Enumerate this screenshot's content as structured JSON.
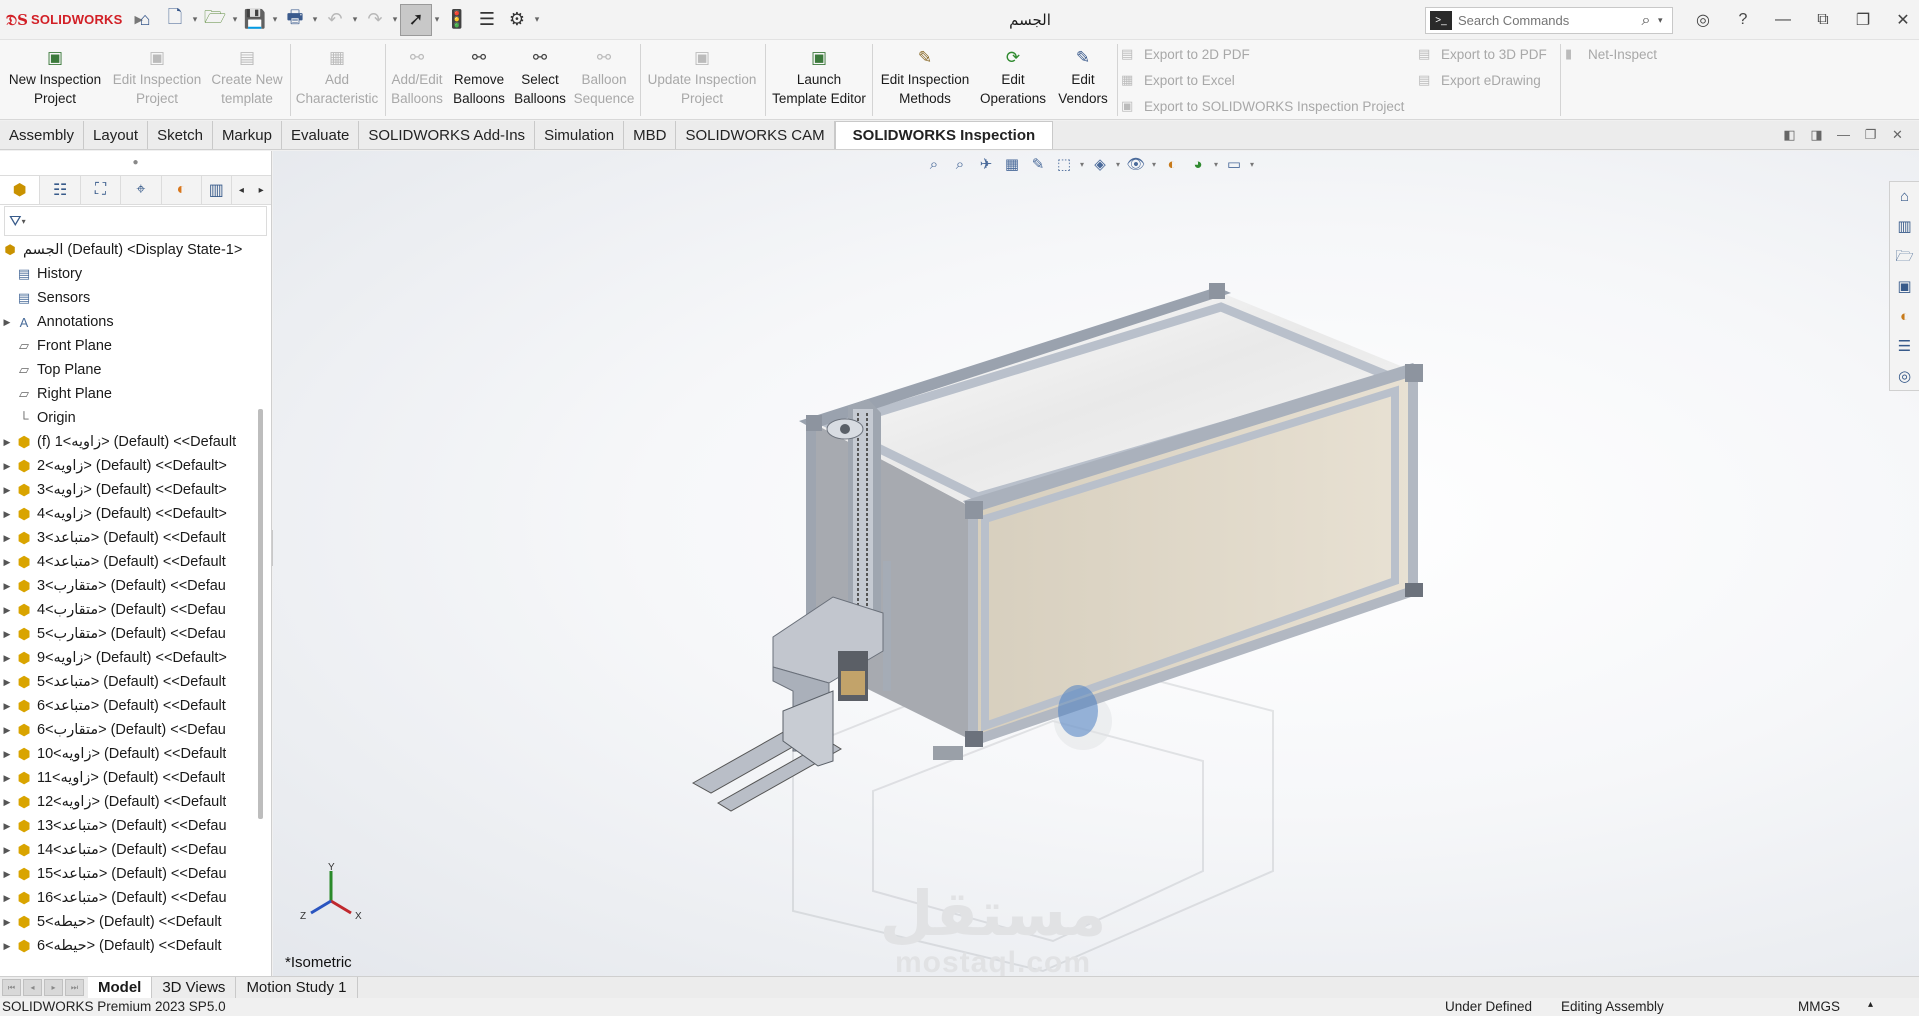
{
  "app": {
    "brand": "SOLIDWORKS",
    "document_title": "الجسم"
  },
  "search": {
    "placeholder": "Search Commands"
  },
  "commands": {
    "new_inspection_project": "New Inspection Project",
    "edit_inspection_project": "Edit Inspection Project",
    "create_new_template": "Create New template",
    "add_characteristic": "Add Characteristic",
    "add_edit_balloons": "Add/Edit Balloons",
    "remove_balloons": "Remove Balloons",
    "select_balloons": "Select Balloons",
    "balloon_sequence": "Balloon Sequence",
    "update_inspection_project": "Update Inspection Project",
    "launch_template_editor": "Launch Template Editor",
    "edit_inspection_methods": "Edit Inspection Methods",
    "edit_operations": "Edit Operations",
    "edit_vendors": "Edit Vendors",
    "export_2d_pdf": "Export to 2D PDF",
    "export_excel": "Export to Excel",
    "export_sw_inspection": "Export to SOLIDWORKS Inspection Project",
    "export_3d_pdf": "Export to 3D PDF",
    "export_edrawing": "Export eDrawing",
    "net_inspect": "Net-Inspect"
  },
  "tabs": [
    "Assembly",
    "Layout",
    "Sketch",
    "Markup",
    "Evaluate",
    "SOLIDWORKS Add-Ins",
    "Simulation",
    "MBD",
    "SOLIDWORKS CAM",
    "SOLIDWORKS Inspection"
  ],
  "active_tab": "SOLIDWORKS Inspection",
  "tree": {
    "root": "الجسم (Default) <Display State-1>",
    "fixed_items": [
      "History",
      "Sensors",
      "Annotations",
      "Front Plane",
      "Top Plane",
      "Right Plane",
      "Origin"
    ],
    "components": [
      "(f) 1<زاويه> (Default) <<Default",
      "2<زاويه> (Default) <<Default>",
      "3<زاويه> (Default) <<Default>",
      "4<زاويه> (Default) <<Default>",
      "3<متباعد> (Default) <<Default",
      "4<متباعد> (Default) <<Default",
      "3<متقارب> (Default) <<Defau",
      "4<متقارب> (Default) <<Defau",
      "5<متقارب> (Default) <<Defau",
      "9<زاويه> (Default) <<Default>",
      "5<متباعد> (Default) <<Default",
      "6<متباعد> (Default) <<Default",
      "6<متقارب> (Default) <<Defau",
      "10<زاويه> (Default) <<Default",
      "11<زاويه> (Default) <<Default",
      "12<زاويه> (Default) <<Default",
      "13<متباعد> (Default) <<Defau",
      "14<متباعد> (Default) <<Defau",
      "15<متباعد> (Default) <<Defau",
      "16<متباعد> (Default) <<Defau",
      "5<حيطه> (Default) <<Default",
      "6<حيطه> (Default) <<Default"
    ]
  },
  "viewport": {
    "view_name": "*Isometric",
    "axes": {
      "x": "X",
      "y": "Y",
      "z": "Z"
    },
    "watermark_ar": "مستقل",
    "watermark_en": "mostaql.com"
  },
  "bottom_tabs": [
    "Model",
    "3D Views",
    "Motion Study 1"
  ],
  "status": {
    "product": "SOLIDWORKS Premium 2023 SP5.0",
    "definition": "Under Defined",
    "mode": "Editing Assembly",
    "units": "MMGS"
  },
  "colors": {
    "brand_red": "#d21f26",
    "frame": "#b8c0cc",
    "panel_tan": "#e2dacb"
  }
}
